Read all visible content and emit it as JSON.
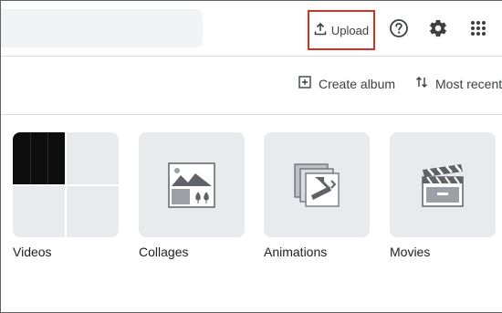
{
  "toolbar": {
    "upload_label": "Upload",
    "help_icon": "help-circle-icon",
    "settings_icon": "gear-icon",
    "apps_icon": "apps-grid-icon"
  },
  "actions": {
    "create_album_label": "Create album",
    "sort_label": "Most recent"
  },
  "categories": [
    {
      "label": "Videos",
      "icon": "video-thumbnails"
    },
    {
      "label": "Collages",
      "icon": "collage-icon"
    },
    {
      "label": "Animations",
      "icon": "animation-icon"
    },
    {
      "label": "Movies",
      "icon": "clapperboard-icon"
    }
  ],
  "colors": {
    "highlight": "#d93025",
    "tile_bg": "#e8eaed",
    "icon": "#5f6368"
  }
}
